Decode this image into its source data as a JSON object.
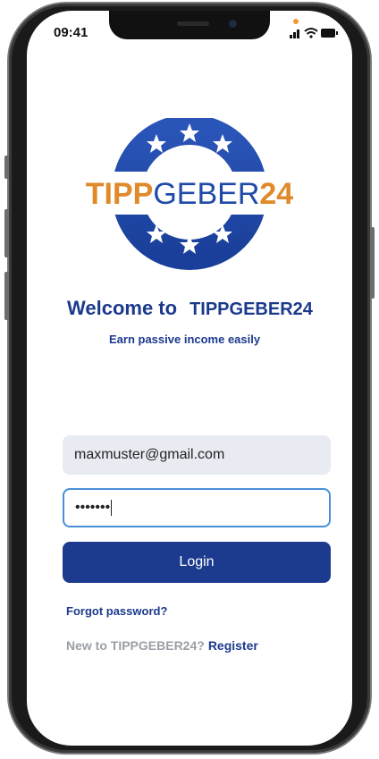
{
  "status_bar": {
    "time": "09:41"
  },
  "logo": {
    "text_part1": "TIPP",
    "text_part2": "GEBER",
    "text_part3": "24",
    "colors": {
      "orange": "#e08a2a",
      "blue": "#1f4aa8",
      "ring": "#2f5fc4"
    }
  },
  "welcome": {
    "prefix": "Welcome to",
    "brand": "TIPPGEBER24",
    "tagline": "Earn passive income easily"
  },
  "form": {
    "email_value": "maxmuster@gmail.com",
    "password_value": "•••••••",
    "login_label": "Login"
  },
  "links": {
    "forgot_password": "Forgot password?",
    "new_user_text": "New to TIPPGEBER24?",
    "register": "Register"
  }
}
